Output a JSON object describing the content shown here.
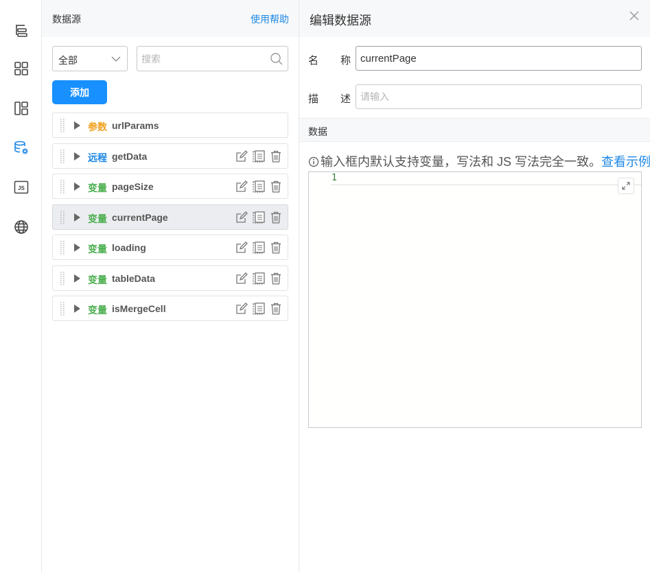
{
  "rail": {
    "items": [
      {
        "icon": "outline-tree-icon"
      },
      {
        "icon": "components-grid-icon"
      },
      {
        "icon": "page-layout-icon"
      },
      {
        "icon": "datasource-icon"
      },
      {
        "icon": "js-code-icon"
      },
      {
        "icon": "globe-icon"
      }
    ],
    "active_color": "#1e88e5"
  },
  "datasource_panel": {
    "title": "数据源",
    "help_link": "使用帮助",
    "filter_selected": "全部",
    "search_placeholder": "搜索",
    "add_button": "添加",
    "items": [
      {
        "type": "参数",
        "type_kind": "param",
        "name": "urlParams",
        "has_actions": false,
        "active": false
      },
      {
        "type": "远程",
        "type_kind": "remote",
        "name": "getData",
        "has_actions": true,
        "active": false
      },
      {
        "type": "变量",
        "type_kind": "var",
        "name": "pageSize",
        "has_actions": true,
        "active": false
      },
      {
        "type": "变量",
        "type_kind": "var",
        "name": "currentPage",
        "has_actions": true,
        "active": true
      },
      {
        "type": "变量",
        "type_kind": "var",
        "name": "loading",
        "has_actions": true,
        "active": false
      },
      {
        "type": "变量",
        "type_kind": "var",
        "name": "tableData",
        "has_actions": true,
        "active": false
      },
      {
        "type": "变量",
        "type_kind": "var",
        "name": "isMergeCell",
        "has_actions": true,
        "active": false
      }
    ],
    "colors": {
      "param": "#f0a01e",
      "remote": "#1e88e5",
      "var": "#4caf50",
      "accent": "#1890ff"
    }
  },
  "editor_panel": {
    "title": "编辑数据源",
    "name_label_1": "名",
    "name_label_2": "称",
    "name_value": "currentPage",
    "desc_label_1": "描",
    "desc_label_2": "述",
    "desc_placeholder": "请输入",
    "data_section": "数据",
    "hint_text": "输入框内默认支持变量，写法和 JS 写法完全一致。",
    "hint_link": "查看示例",
    "editor_line_number": "1"
  }
}
